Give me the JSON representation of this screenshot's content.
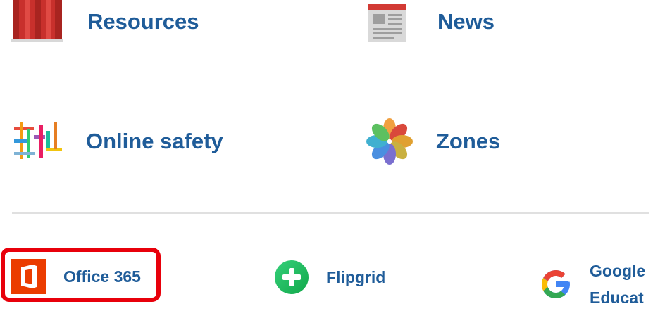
{
  "tiles": {
    "resources": {
      "label": "Resources",
      "icon": "resources-icon"
    },
    "news": {
      "label": "News",
      "icon": "newspaper-icon"
    },
    "online_safety": {
      "label": "Online safety",
      "icon": "online-safety-icon"
    },
    "zones": {
      "label": "Zones",
      "icon": "zones-flower-icon"
    }
  },
  "apps": {
    "office365": {
      "label": "Office 365",
      "icon": "office365-icon",
      "highlighted": true
    },
    "flipgrid": {
      "label": "Flipgrid",
      "icon": "flipgrid-icon"
    },
    "google": {
      "label_line1": "Google",
      "label_line2": "Educat",
      "icon": "google-icon"
    }
  },
  "colors": {
    "link_text": "#1f5c99",
    "highlight": "#e8000b",
    "office_orange": "#eb3c00",
    "flipgrid_green": "#21c25e",
    "divider": "#e0e0e0"
  }
}
